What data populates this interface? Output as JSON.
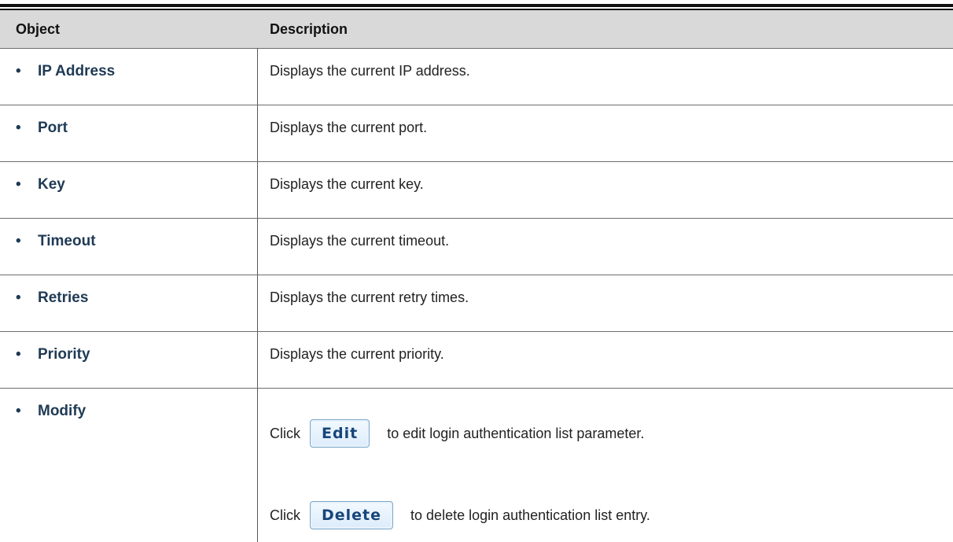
{
  "header": {
    "object": "Object",
    "description": "Description"
  },
  "bullet_symbol": "•",
  "rows": [
    {
      "object": "IP Address",
      "description": "Displays the current IP address."
    },
    {
      "object": "Port",
      "description": "Displays the current port."
    },
    {
      "object": "Key",
      "description": "Displays the current key."
    },
    {
      "object": "Timeout",
      "description": "Displays the current timeout."
    },
    {
      "object": "Retries",
      "description": "Displays the current retry times."
    },
    {
      "object": "Priority",
      "description": "Displays the current priority."
    }
  ],
  "modify": {
    "object": "Modify",
    "edit": {
      "prefix": "Click",
      "button": "Edit",
      "suffix": "to edit login authentication list parameter."
    },
    "delete": {
      "prefix": "Click",
      "button": "Delete",
      "suffix": "to delete login authentication list entry."
    }
  }
}
